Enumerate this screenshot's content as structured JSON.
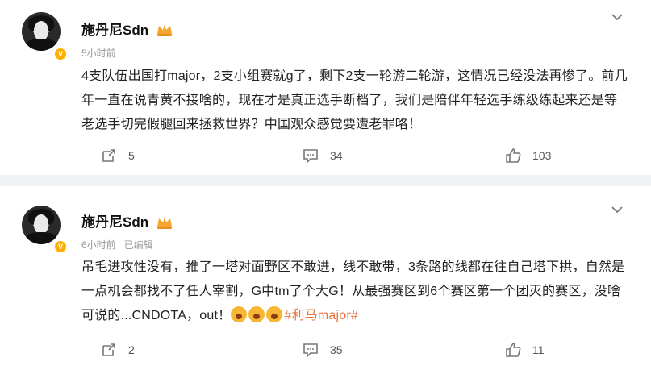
{
  "posts": [
    {
      "author": "施丹尼Sdn",
      "time": "5小时前",
      "edited": "",
      "text": "4支队伍出国打major，2支小组赛就g了，剩下2支一轮游二轮游，这情况已经没法再惨了。前几年一直在说青黄不接啥的，现在才是真正选手断档了，我们是陪伴年轻选手练级练起来还是等老选手切完假腿回来拯救世界？中国观众感觉要遭老罪咯！",
      "hashtag": "",
      "reposts": "5",
      "comments": "34",
      "likes": "103"
    },
    {
      "author": "施丹尼Sdn",
      "time": "6小时前",
      "edited": "已编辑",
      "text": "吊毛进攻性没有，推了一塔对面野区不敢进，线不敢带，3条路的线都在往自己塔下拱，自然是一点机会都找不了任人宰割，G中tm了个大G！从最强赛区到6个赛区第一个团灭的赛区，没啥可说的...CNDOTA，out！",
      "hashtag": "#利马major#",
      "reposts": "2",
      "comments": "35",
      "likes": "11"
    }
  ],
  "icons": {
    "repost": "repost-icon",
    "comment": "comment-icon",
    "like": "like-icon",
    "more": "chevron-down-icon",
    "verified": "verified-badge-icon",
    "crown": "vip-crown-icon"
  },
  "colors": {
    "background": "#f1f2f5",
    "card": "#ffffff",
    "hashtag": "#eb7340",
    "muted": "#999999",
    "verified": "#ffb000"
  }
}
